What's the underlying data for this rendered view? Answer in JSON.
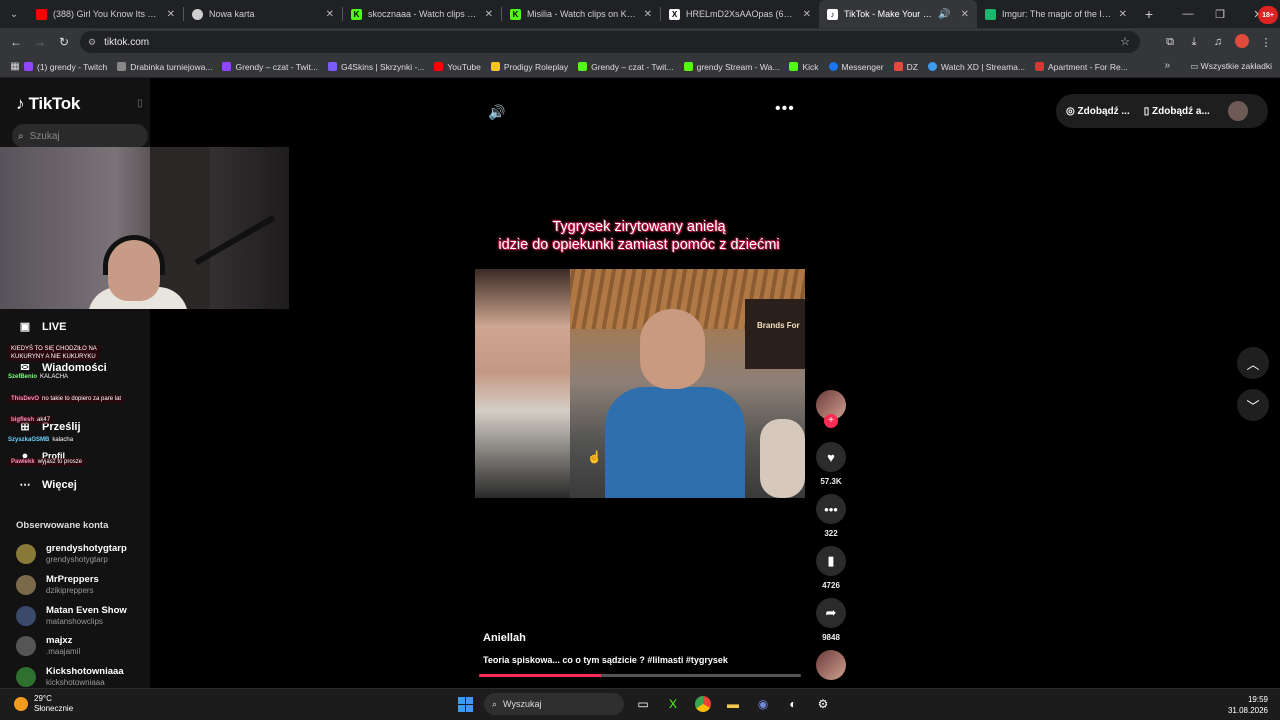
{
  "browser": {
    "tabs": [
      {
        "title": "(388) Girl You Know Its True (Ra",
        "icon": "youtube-icon",
        "color": "#ff0000"
      },
      {
        "title": "Nowa karta",
        "icon": "chrome-icon",
        "color": "#cfcfcf"
      },
      {
        "title": "skocznaaa - Watch clips on Kick",
        "icon": "kick-icon",
        "color": "#53fc18"
      },
      {
        "title": "Misilia - Watch clips on Kick",
        "icon": "kick-icon",
        "color": "#53fc18"
      },
      {
        "title": "HRELmD2XsAAOpas (658×491)",
        "icon": "x-icon",
        "color": "#ffffff"
      },
      {
        "title": "TikTok - Make Your Day",
        "icon": "tiktok-icon",
        "color": "#ffffff"
      },
      {
        "title": "Imgur: The magic of the Interne",
        "icon": "imgur-icon",
        "color": "#1bb76e"
      }
    ],
    "url": "tiktok.com",
    "bookmarks": [
      {
        "label": "(1) grendy - Twitch",
        "color": "#9146ff"
      },
      {
        "label": "Drabinka turniejowa...",
        "color": "#888888"
      },
      {
        "label": "Grendy – czat - Twit...",
        "color": "#9146ff"
      },
      {
        "label": "G4Skins | Skrzynki -...",
        "color": "#7d5cff"
      },
      {
        "label": "YouTube",
        "color": "#ff0000"
      },
      {
        "label": "Prodigy Roleplay",
        "color": "#f5c518"
      },
      {
        "label": "Grendy – czat - Twit...",
        "color": "#53fc18"
      },
      {
        "label": "grendy Stream - Wa...",
        "color": "#53fc18"
      },
      {
        "label": "Kick",
        "color": "#53fc18"
      },
      {
        "label": "Messenger",
        "color": "#1877f2"
      },
      {
        "label": "DZ",
        "color": "#e14b3b"
      },
      {
        "label": "Watch XD | Streama...",
        "color": "#3b9cf0"
      },
      {
        "label": "Apartment - For Re...",
        "color": "#d33"
      }
    ],
    "all_bookmarks": "Wszystkie zakładki"
  },
  "tiktok": {
    "logo": "TikTok",
    "search_placeholder": "Szukaj",
    "nav": {
      "live": "LIVE",
      "messages": "Wiadomości",
      "upload": "Prześlij",
      "profile": "Profil",
      "more": "Więcej"
    },
    "following_title": "Obserwowane konta",
    "following": [
      {
        "name": "grendyshotygtarp",
        "handle": "grendyshotygtarp",
        "color": "#8a7a3a"
      },
      {
        "name": "MrPreppers",
        "handle": "dzikipreppers",
        "color": "#7a6a4a"
      },
      {
        "name": "Matan Even Show",
        "handle": "matanshowclips",
        "color": "#3a4a6a"
      },
      {
        "name": "majxz",
        "handle": ".maajamil",
        "color": "#555555"
      },
      {
        "name": "Kickshotowniaaa",
        "handle": "kickshotowniaaa",
        "color": "#2f6f2f"
      }
    ],
    "top_right": {
      "coins": "Zdobądź ...",
      "app": "Zdobądź a..."
    },
    "video": {
      "caption_line1": "Tygrysek zirytowany anielą",
      "caption_line2": "idzie do opiekunki zamiast pomóc z dziećmi",
      "scene_sign": "Brands For",
      "author": "Aniellah",
      "description": "Teoria spiskowa... co o tym sądzicie ? #lilmasti  #tygrysek",
      "progress": 0.38
    },
    "actions": {
      "likes": "57.3K",
      "comments": "322",
      "saves": "4726",
      "shares": "9848"
    }
  },
  "stream_chat": [
    {
      "user": "",
      "text": "KIEDYŚ TO SIĘ CHODZIŁO NA",
      "user_color": "#ff6b6b"
    },
    {
      "user": "",
      "text": "KUKURYNY A NIE KUKURYKU",
      "user_color": "#ff6b6b"
    },
    {
      "user": "SzefBenio",
      "text": "KALACHA",
      "user_color": "#7cff7c"
    },
    {
      "user": "ThisDevO",
      "text": "no takie to dopiero za pare lat",
      "user_color": "#ff8fbf"
    },
    {
      "user": "bigflesh",
      "text": "ak47",
      "user_color": "#ff8fbf"
    },
    {
      "user": "SzyszkaGSMB",
      "text": "kalacha",
      "user_color": "#6bd6ff"
    },
    {
      "user": "Pawlekk",
      "text": "wyjasz to prosze",
      "user_color": "#ff8fbf"
    }
  ],
  "taskbar": {
    "temp": "29°C",
    "weather": "Słonecznie",
    "search": "Wyszukaj",
    "time": "19:59",
    "date": "31.08.2026"
  }
}
